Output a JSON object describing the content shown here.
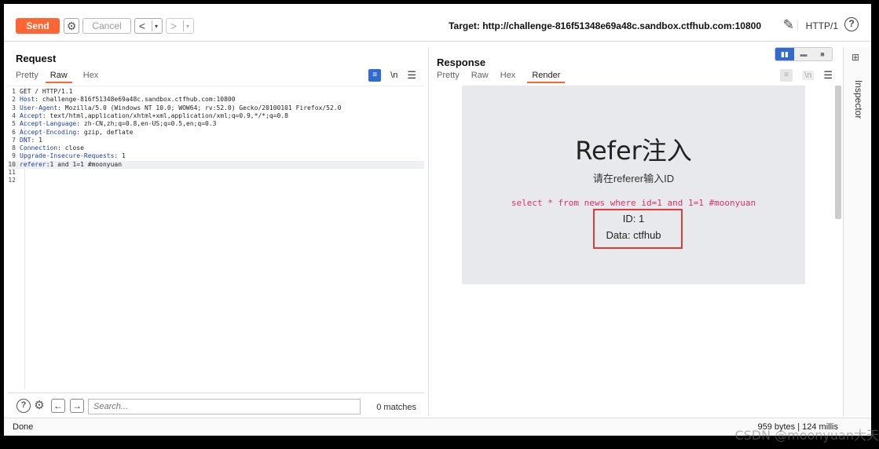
{
  "toolbar": {
    "send_label": "Send",
    "cancel_label": "Cancel",
    "back_label": "<",
    "forward_label": ">",
    "dropdown_glyph": "▾",
    "target": "Target: http://challenge-816f51348e69a48c.sandbox.ctfhub.com:10800",
    "http_version": "HTTP/1",
    "help_glyph": "?"
  },
  "request": {
    "title": "Request",
    "tabs": [
      "Pretty",
      "Raw",
      "Hex"
    ],
    "active_tab": "Raw",
    "newline_label": "\\n",
    "lines": [
      {
        "n": "1",
        "name": "",
        "val": "GET / HTTP/1.1"
      },
      {
        "n": "2",
        "name": "Host",
        "val": ": challenge-816f51348e69a48c.sandbox.ctfhub.com:10800"
      },
      {
        "n": "3",
        "name": "User-Agent",
        "val": ": Mozilla/5.0 (Windows NT 10.0; WOW64; rv:52.0) Gecko/20100101 Firefox/52.0"
      },
      {
        "n": "4",
        "name": "Accept",
        "val": ": text/html,application/xhtml+xml,application/xml;q=0.9,*/*;q=0.8"
      },
      {
        "n": "5",
        "name": "Accept-Language",
        "val": ": zh-CN,zh;q=0.8,en-US;q=0.5,en;q=0.3"
      },
      {
        "n": "6",
        "name": "Accept-Encoding",
        "val": ": gzip, deflate"
      },
      {
        "n": "7",
        "name": "DNT",
        "val": ": 1"
      },
      {
        "n": "8",
        "name": "Connection",
        "val": ": close"
      },
      {
        "n": "9",
        "name": "Upgrade-Insecure-Requests",
        "val": ": 1"
      },
      {
        "n": "10",
        "name": "referer",
        "val": ":1 and 1=1 #moonyuan"
      },
      {
        "n": "11",
        "name": "",
        "val": ""
      },
      {
        "n": "12",
        "name": "",
        "val": ""
      }
    ],
    "search_placeholder": "Search...",
    "matches": "0 matches"
  },
  "response": {
    "title": "Response",
    "tabs": [
      "Pretty",
      "Raw",
      "Hex",
      "Render"
    ],
    "active_tab": "Render",
    "newline_label": "\\n",
    "render": {
      "heading": "Refer注入",
      "subtitle": "请在referer输入ID",
      "sql": "select * from news where id=1 and 1=1 #moonyuan",
      "id_line": "ID: 1",
      "data_line": "Data: ctfhub"
    }
  },
  "inspector": {
    "label": "Inspector"
  },
  "status": {
    "left": "Done",
    "right": "959 bytes | 124 millis"
  },
  "watermark": "CSDN @moonyuan大天",
  "colors": {
    "send": "#ff6633",
    "accent": "#2f6bd1",
    "sql": "#d6336c",
    "highlight_box": "#e03a3a"
  }
}
